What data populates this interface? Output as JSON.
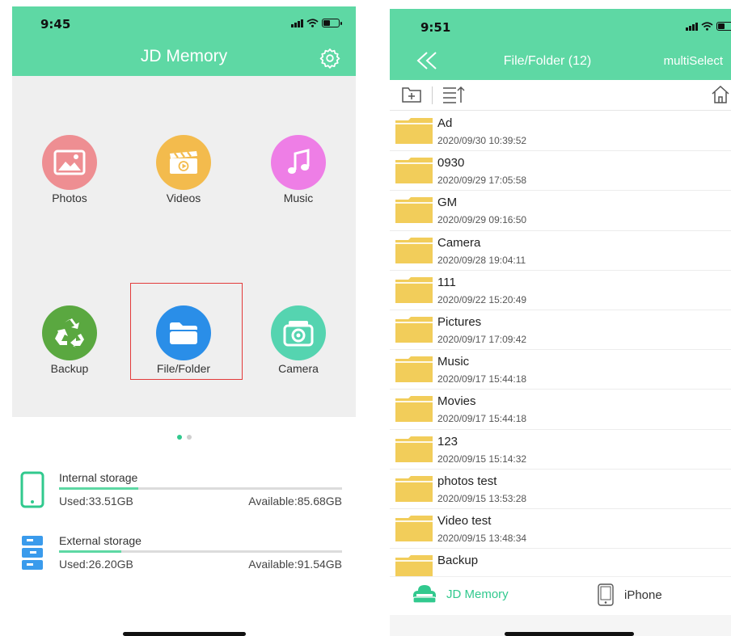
{
  "left": {
    "status": {
      "time": "9:45"
    },
    "header": {
      "title": "JD Memory"
    },
    "apps": [
      {
        "label": "Photos"
      },
      {
        "label": "Videos"
      },
      {
        "label": "Music"
      },
      {
        "label": "Backup"
      },
      {
        "label": "File/Folder"
      },
      {
        "label": "Camera"
      }
    ],
    "pages": {
      "count": 2,
      "active": 1
    },
    "storage": [
      {
        "name": "Internal storage",
        "used": "Used:33.51GB",
        "available": "Available:85.68GB",
        "used_fraction": 0.28
      },
      {
        "name": "External storage",
        "used": "Used:26.20GB",
        "available": "Available:91.54GB",
        "used_fraction": 0.22
      }
    ]
  },
  "right": {
    "status": {
      "time": "9:51"
    },
    "header": {
      "title": "File/Folder (12)",
      "action": "multiSelect"
    },
    "files": [
      {
        "name": "Ad",
        "date": "2020/09/30 10:39:52"
      },
      {
        "name": "0930",
        "date": "2020/09/29 17:05:58"
      },
      {
        "name": "GM",
        "date": "2020/09/29 09:16:50"
      },
      {
        "name": "Camera",
        "date": "2020/09/28 19:04:11"
      },
      {
        "name": "111",
        "date": "2020/09/22 15:20:49"
      },
      {
        "name": "Pictures",
        "date": "2020/09/17 17:09:42"
      },
      {
        "name": "Music",
        "date": "2020/09/17 15:44:18"
      },
      {
        "name": "Movies",
        "date": "2020/09/17 15:44:18"
      },
      {
        "name": "123",
        "date": "2020/09/15 15:14:32"
      },
      {
        "name": "photos test",
        "date": "2020/09/15 13:53:28"
      },
      {
        "name": "Video test",
        "date": "2020/09/15 13:48:34"
      },
      {
        "name": "Backup",
        "date": ""
      }
    ],
    "tabs": [
      {
        "label": "JD Memory",
        "active": true
      },
      {
        "label": "iPhone",
        "active": false
      }
    ]
  },
  "colors": {
    "accent": "#5ed8a4",
    "folder": "#f2cd5a",
    "selection": "#e23a3a",
    "photos": "#ee8e92",
    "videos": "#f3bb4d",
    "music": "#ee7ee6",
    "backup": "#5aa840",
    "file_folder": "#2a8ee8",
    "camera": "#55d4b0",
    "storage_icon_internal": "#31c98e",
    "storage_icon_external": "#3a9bec"
  },
  "icons": {
    "settings": "gear-icon",
    "back": "double-chevron-left-icon",
    "new_folder": "new-folder-icon",
    "sort": "sort-icon",
    "home": "home-icon",
    "internal_storage": "phone-icon",
    "external_storage": "server-icon"
  }
}
